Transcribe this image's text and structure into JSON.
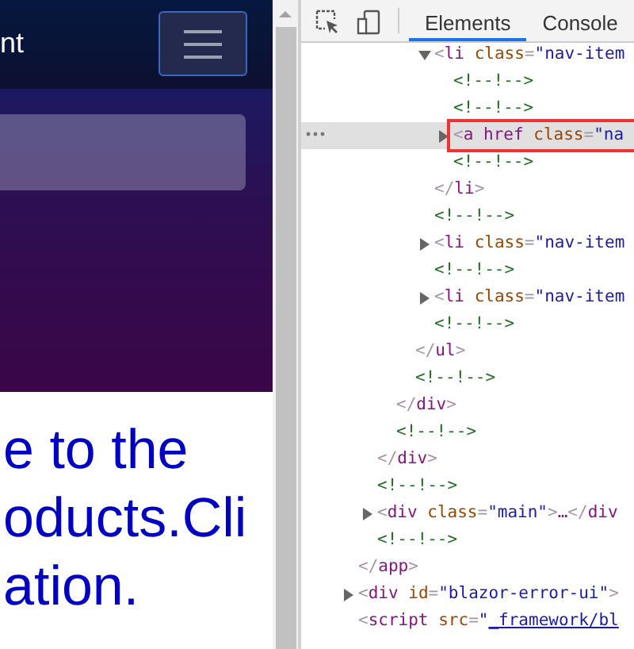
{
  "page": {
    "brand": "nt",
    "nav_item": {
      "selected": true
    },
    "heading_lines": [
      "e to the",
      "oducts.Cli",
      "ation."
    ]
  },
  "devtools": {
    "tabs": [
      {
        "label": "Elements",
        "selected": true
      },
      {
        "label": "Console",
        "selected": false
      }
    ],
    "tree": [
      {
        "children": [
          {
            "children": [
              {
                "children": [
                  {
                    "children": [
                      {
                        "kind": "tag",
                        "text": "<li class=\"nav-item",
                        "expanded": true,
                        "selected": false,
                        "children": [
                          {
                            "kind": "comment",
                            "text": "<!--!-->",
                            "selected": false
                          },
                          {
                            "kind": "comment",
                            "text": "<!--!-->",
                            "selected": false
                          },
                          {
                            "kind": "tag",
                            "text": "<a href class=\"na",
                            "expanded": false,
                            "selected": true
                          },
                          {
                            "kind": "comment",
                            "text": "<!--!-->",
                            "selected": false
                          }
                        ]
                      },
                      {
                        "kind": "tag",
                        "text": "</li>",
                        "selected": false
                      },
                      {
                        "kind": "comment",
                        "text": "<!--!-->",
                        "selected": false
                      },
                      {
                        "kind": "tag",
                        "text": "<li class=\"nav-item",
                        "expanded": false,
                        "selected": false
                      },
                      {
                        "kind": "comment",
                        "text": "<!--!-->",
                        "selected": false
                      },
                      {
                        "kind": "tag",
                        "text": "<li class=\"nav-item",
                        "expanded": false,
                        "selected": false
                      },
                      {
                        "kind": "comment",
                        "text": "<!--!-->",
                        "selected": false
                      }
                    ]
                  },
                  {
                    "kind": "tag",
                    "text": "</ul>",
                    "selected": false
                  },
                  {
                    "kind": "comment",
                    "text": "<!--!-->",
                    "selected": false
                  }
                ]
              },
              {
                "kind": "tag",
                "text": "</div>",
                "selected": false
              },
              {
                "kind": "comment",
                "text": "<!--!-->",
                "selected": false
              }
            ]
          },
          {
            "kind": "tag",
            "text": "</div>",
            "selected": false
          },
          {
            "kind": "comment",
            "text": "<!--!-->",
            "selected": false
          },
          {
            "kind": "tag",
            "text": "<div class=\"main\">…</div",
            "expanded": false,
            "selected": false
          },
          {
            "kind": "comment",
            "text": "<!--!-->",
            "selected": false
          }
        ]
      },
      {
        "kind": "tag",
        "text": "</app>",
        "selected": false
      },
      {
        "kind": "tag",
        "text": "<div id=\"blazor-error-ui\">",
        "expanded": false,
        "selected": false
      },
      {
        "kind": "tag",
        "text": "<script src=\"_framework/bl",
        "link": true,
        "selected": false
      }
    ]
  }
}
